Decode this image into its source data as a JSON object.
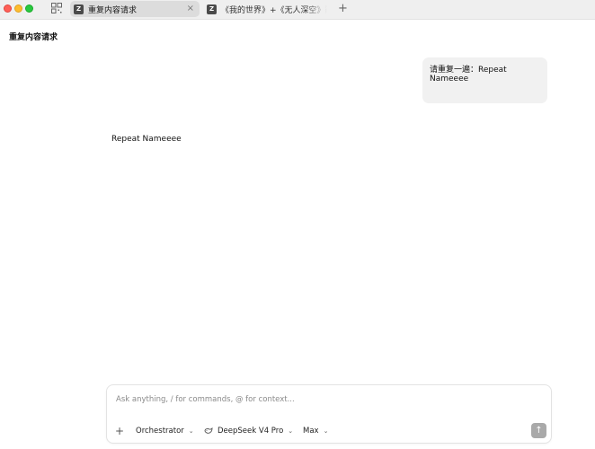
{
  "tabs": [
    {
      "label": "重复内容请求",
      "icon_letter": "Z",
      "active": true
    },
    {
      "label": "《我的世界》+《无人深空》融合",
      "icon_letter": "Z",
      "active": false
    }
  ],
  "icons": {
    "sidebar_toggle": "sidebar-toggle-icon",
    "tab_close": "×",
    "new_tab": "+",
    "add": "+",
    "chevron": "⌄",
    "send": "↑",
    "model": "whale-icon"
  },
  "page": {
    "title": "重复内容请求"
  },
  "messages": [
    {
      "role": "user",
      "text": "请重复一遍：Repeat Nameeee"
    },
    {
      "role": "assistant",
      "text": "Repeat Nameeee"
    }
  ],
  "composer": {
    "placeholder": "Ask anything, / for commands, @ for context...",
    "mode_label": "Orchestrator",
    "model_label": "DeepSeek V4 Pro",
    "effort_label": "Max"
  },
  "colors": {
    "traffic_red": "#ff5f57",
    "traffic_yellow": "#febc2e",
    "traffic_green": "#28c840",
    "send_button": "#a9a9a9",
    "user_bubble": "#f1f1f1"
  }
}
